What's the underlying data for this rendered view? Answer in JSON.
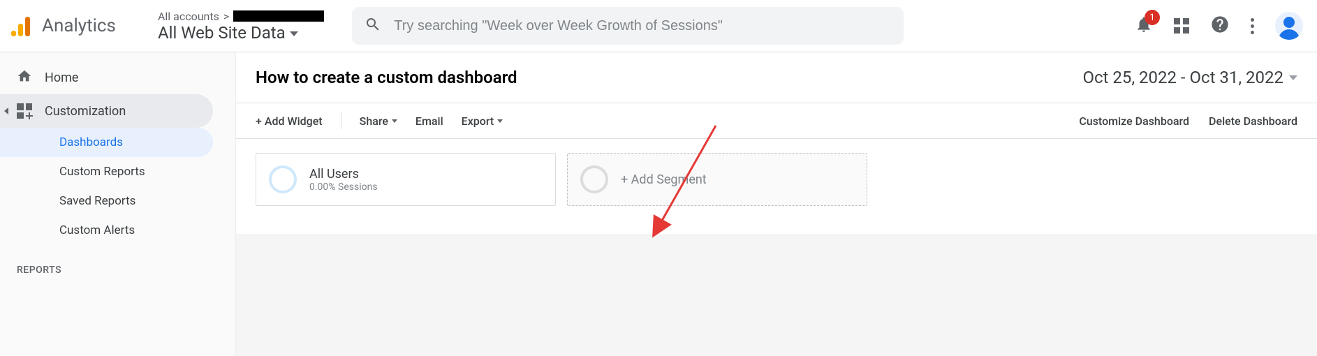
{
  "product_name": "Analytics",
  "view_picker": {
    "breadcrumb_prefix": "All accounts",
    "breadcrumb_separator": ">",
    "view_name": "All Web Site Data"
  },
  "search": {
    "placeholder": "Try searching \"Week over Week Growth of Sessions\""
  },
  "notifications": {
    "count": "1"
  },
  "nav": {
    "home": "Home",
    "customization": "Customization",
    "items": [
      "Dashboards",
      "Custom Reports",
      "Saved Reports",
      "Custom Alerts"
    ],
    "reports_heading": "REPORTS"
  },
  "dashboard": {
    "title": "How to create a custom dashboard",
    "date_range": "Oct 25, 2022 - Oct 31, 2022",
    "toolbar": {
      "add_widget": "+ Add Widget",
      "share": "Share",
      "email": "Email",
      "export": "Export",
      "customize": "Customize Dashboard",
      "delete": "Delete Dashboard"
    },
    "segments": {
      "primary_name": "All Users",
      "primary_sub": "0.00% Sessions",
      "add_label": "+ Add Segment"
    }
  }
}
